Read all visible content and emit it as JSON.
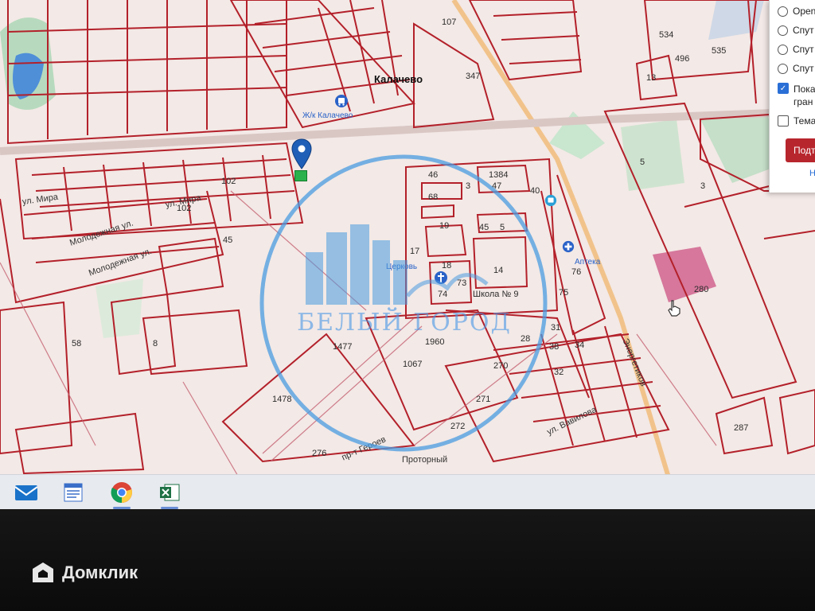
{
  "map": {
    "district": "Калачево",
    "street_labels": [
      "ул. Мира",
      "ул. Мира",
      "Молодежная ул.",
      "Молодежная ул.",
      "Энергетиков",
      "ул. Вавилова",
      "пр-т Героев",
      "Проторный"
    ],
    "poi": {
      "bus_stop": "Ж/к Калачево",
      "church": "Церковь",
      "school": "Школа № 9",
      "pharmacy": "Аптека"
    },
    "parcel_numbers": [
      "107",
      "347",
      "534",
      "535",
      "496",
      "13",
      "5",
      "3",
      "102",
      "102",
      "45",
      "46",
      "68",
      "1384",
      "3",
      "47",
      "40",
      "45",
      "5",
      "19",
      "18",
      "14",
      "17",
      "74",
      "73",
      "75",
      "76",
      "280",
      "58",
      "8",
      "1477",
      "1960",
      "1067",
      "1478",
      "270",
      "271",
      "272",
      "28",
      "31",
      "38",
      "34",
      "32",
      "276",
      "287"
    ]
  },
  "layer_panel": {
    "options": [
      "Open",
      "Спут",
      "Спут",
      "Спут"
    ],
    "checkbox_show": "Пока",
    "checkbox_show_line2": "гран",
    "checkbox_theme": "Тема",
    "submit_button": "Подт",
    "link": "Н"
  },
  "watermark": {
    "text": "БЕЛЫЙ ГОРОД"
  },
  "taskbar": {
    "apps": [
      "mail-icon",
      "notepad-icon",
      "chrome-icon",
      "excel-icon"
    ]
  },
  "brand": {
    "name": "Домклик"
  },
  "colors": {
    "parcel_line": "#b3202a",
    "map_bg": "#f3e9e6",
    "watermark": "#4a9be0",
    "panel_button": "#b8262d"
  }
}
